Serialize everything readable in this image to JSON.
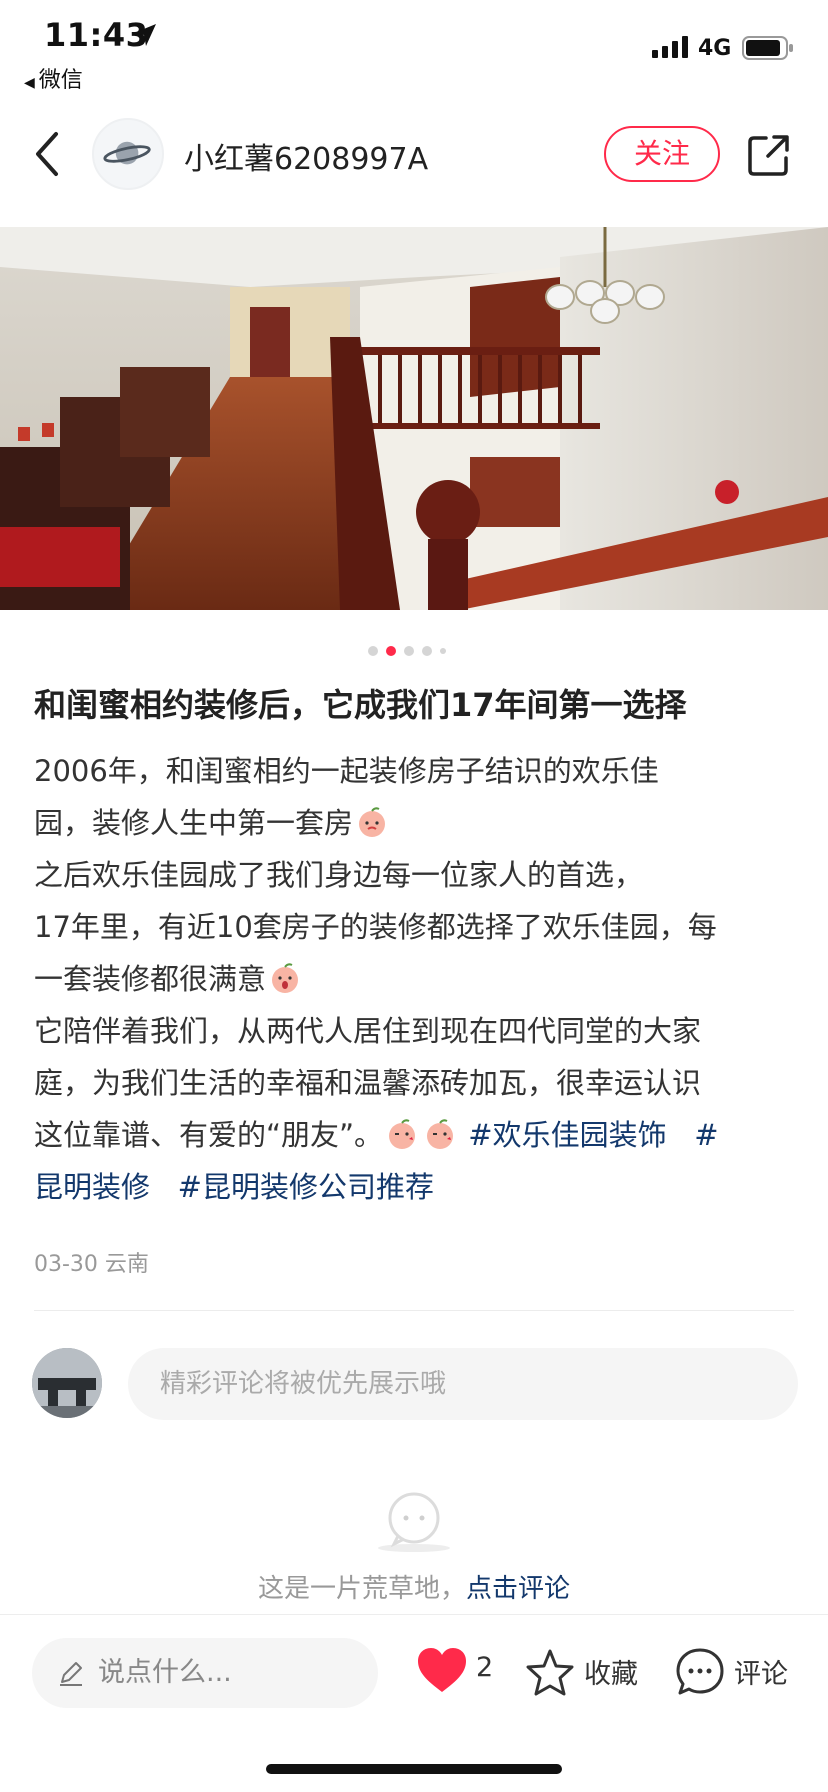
{
  "status_bar": {
    "time": "11:43",
    "back_app": "微信",
    "network": "4G"
  },
  "header": {
    "username": "小红薯6208997A",
    "follow_label": "关注"
  },
  "carousel": {
    "total": 5,
    "active_index": 1
  },
  "post": {
    "title": "和闺蜜相约装修后，它成我们17年间第一选择",
    "lines": [
      "2006年，和闺蜜相约一起装修房子结识的欢乐佳",
      "园，装修人生中第一套房",
      "之后欢乐佳园成了我们身边每一位家人的首选，",
      "17年里，有近10套房子的装修都选择了欢乐佳园，每",
      "一套装修都很满意",
      "它陪伴着我们，从两代人居住到现在四代同堂的大家",
      "庭，为我们生活的幸福和温馨添砖加瓦，很幸运认识",
      "这位靠谱、有爱的“朋友”。"
    ],
    "hashtags": [
      "#欢乐佳园装饰",
      "#",
      "昆明装修",
      "#昆明装修公司推荐"
    ],
    "meta": "03-30 云南"
  },
  "comment": {
    "placeholder": "精彩评论将被优先展示哦",
    "empty_text": "这是一片荒草地，",
    "empty_link": "点击评论"
  },
  "bottom_bar": {
    "say_placeholder": "说点什么...",
    "like_count": "2",
    "fav_label": "收藏",
    "comment_label": "评论"
  },
  "colors": {
    "accent": "#ff2a4a",
    "link": "#13386c"
  }
}
